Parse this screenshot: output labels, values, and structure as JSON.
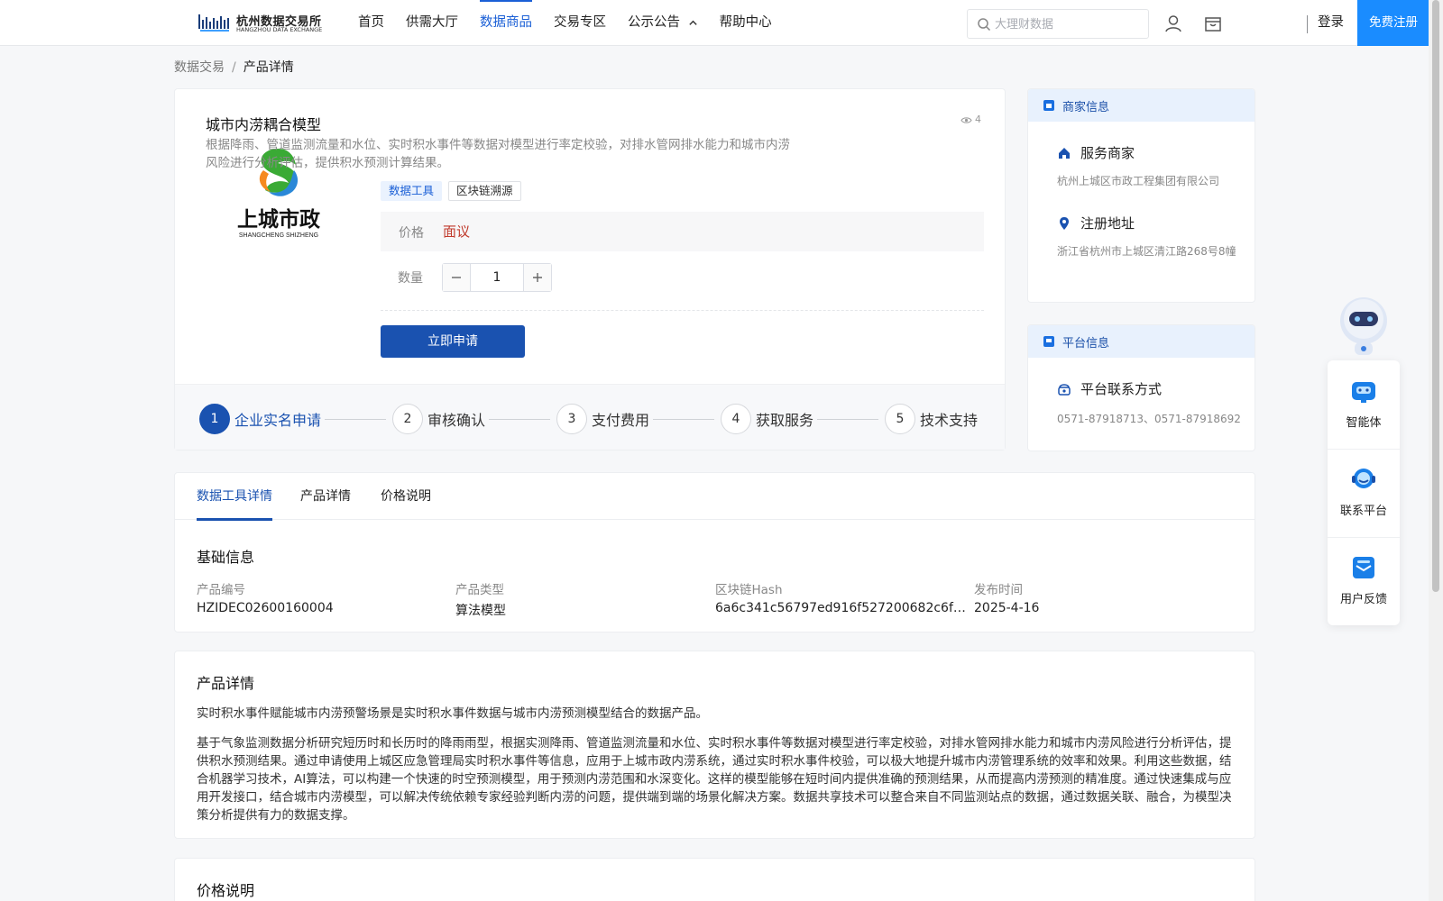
{
  "header": {
    "logo_title": "杭州数据交易所",
    "logo_sub": "HANGZHOU DATA EXCHANGE",
    "nav": [
      {
        "label": "首页"
      },
      {
        "label": "供需大厅"
      },
      {
        "label": "数据商品"
      },
      {
        "label": "交易专区"
      },
      {
        "label": "公示公告"
      },
      {
        "label": "帮助中心"
      }
    ],
    "active_nav": "数据商品",
    "search_placeholder": "大理财数据",
    "login": "登录",
    "register": "免费注册",
    "icons": [
      "user-icon",
      "shop-icon"
    ]
  },
  "breadcrumb": {
    "root": "数据交易",
    "separator": "/",
    "current": "产品详情"
  },
  "product": {
    "logo_text": "上城市政",
    "logo_sub": "SHANGCHENG SHIZHENG",
    "title": "城市内涝耦合模型",
    "views": "4",
    "description": "根据降雨、管道监测流量和水位、实时积水事件等数据对模型进行率定校验，对排水管网排水能力和城市内涝风险进行分析评估，提供积水预测计算结果。",
    "tags": [
      "数据工具",
      "区块链溯源"
    ],
    "price_label": "价格",
    "price_value": "面议",
    "qty_label": "数量",
    "qty_value": "1",
    "apply_label": "立即申请",
    "steps": [
      {
        "num": "1",
        "label": "企业实名申请",
        "active": true
      },
      {
        "num": "2",
        "label": "审核确认",
        "active": false
      },
      {
        "num": "3",
        "label": "支付费用",
        "active": false
      },
      {
        "num": "4",
        "label": "获取服务",
        "active": false
      },
      {
        "num": "5",
        "label": "技术支持",
        "active": false
      }
    ]
  },
  "merchant": {
    "header": "商家信息",
    "service_title": "服务商家",
    "service_value": "杭州上城区市政工程集团有限公司",
    "address_title": "注册地址",
    "address_value": "浙江省杭州市上城区清江路268号8幢"
  },
  "platform": {
    "header": "平台信息",
    "contact_title": "平台联系方式",
    "contact_value": "0571-87918713、0571-87918692"
  },
  "float_bar": {
    "items": [
      "智能体",
      "联系平台",
      "用户反馈"
    ]
  },
  "tabs": {
    "items": [
      "数据工具详情",
      "产品详情",
      "价格说明"
    ],
    "active": "数据工具详情"
  },
  "basic_info": {
    "title": "基础信息",
    "fields": [
      {
        "label": "产品编号",
        "value": "HZIDEC02600160004"
      },
      {
        "label": "产品类型",
        "value": "算法模型"
      },
      {
        "label": "区块链Hash",
        "value": "6a6c341c56797ed916f527200682c6f070e..."
      },
      {
        "label": "发布时间",
        "value": "2025-4-16"
      }
    ]
  },
  "detail": {
    "title": "产品详情",
    "para1": "实时积水事件赋能城市内涝预警场景是实时积水事件数据与城市内涝预测模型结合的数据产品。",
    "para2": "基于气象监测数据分析研究短历时和长历时的降雨雨型，根据实测降雨、管道监测流量和水位、实时积水事件等数据对模型进行率定校验，对排水管网排水能力和城市内涝风险进行分析评估，提供积水预测结果。通过申请使用上城区应急管理局实时积水事件等信息，应用于上城市政内涝系统，通过实时积水事件校验，可以极大地提升城市内涝管理系统的效率和效果。利用这些数据，结合机器学习技术，AI算法，可以构建一个快速的时空预测模型，用于预测内涝范围和水深变化。这样的模型能够在短时间内提供准确的预测结果，从而提高内涝预测的精准度。通过快速集成与应用开发接口，结合城市内涝模型，可以解决传统依赖专家经验判断内涝的问题，提供端到端的场景化解决方案。数据共享技术可以整合来自不同监测站点的数据，通过数据关联、融合，为模型决策分析提供有力的数据支撑。"
  },
  "price_section": {
    "title": "价格说明"
  },
  "colors": {
    "primary": "#1a52b0",
    "link": "#1a5fd6",
    "register": "#1a8cff",
    "price": "#c0392b"
  }
}
